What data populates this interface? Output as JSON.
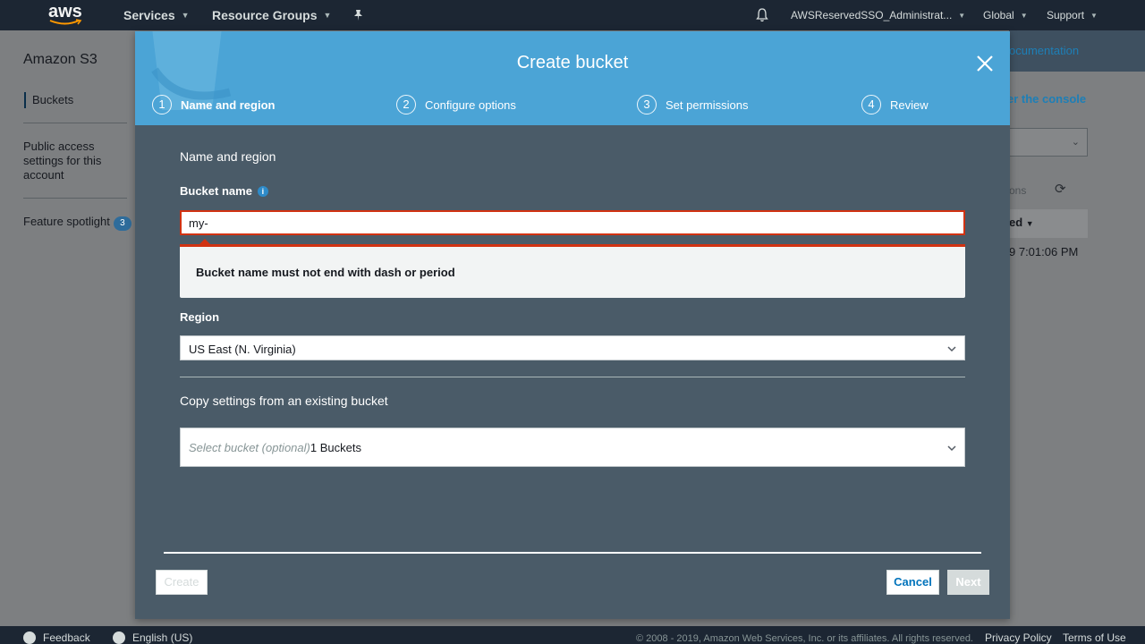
{
  "topnav": {
    "logo": "aws",
    "services": "Services",
    "resource_groups": "Resource Groups",
    "account": "AWSReservedSSO_Administrat...",
    "region": "Global",
    "support": "Support"
  },
  "background": {
    "service_title": "Amazon S3",
    "nav": {
      "buckets": "Buckets",
      "public_access": "Public access settings for this account",
      "feature_spotlight": "Feature spotlight",
      "feature_spotlight_count": "3"
    },
    "doc_link": "ocumentation",
    "console_link": "er the console",
    "options_text": "ons",
    "table_header": "ed",
    "table_cell": "9 7:01:06 PM"
  },
  "modal": {
    "title": "Create bucket",
    "steps": [
      {
        "num": "1",
        "label": "Name and region"
      },
      {
        "num": "2",
        "label": "Configure options"
      },
      {
        "num": "3",
        "label": "Set permissions"
      },
      {
        "num": "4",
        "label": "Review"
      }
    ],
    "section_title": "Name and region",
    "bucket_name_label": "Bucket name",
    "bucket_name_value": "my-",
    "error_message": "Bucket name must not end with dash or period",
    "region_label": "Region",
    "region_value": "US East (N. Virginia)",
    "copy_title": "Copy settings from an existing bucket",
    "copy_placeholder": "Select bucket (optional)",
    "copy_count": "1 Buckets",
    "buttons": {
      "create": "Create",
      "cancel": "Cancel",
      "next": "Next"
    }
  },
  "footer": {
    "feedback": "Feedback",
    "language": "English (US)",
    "copyright": "© 2008 - 2019, Amazon Web Services, Inc. or its affiliates. All rights reserved.",
    "privacy": "Privacy Policy",
    "terms": "Terms of Use"
  },
  "colors": {
    "header_blue": "#4ba4d6",
    "modal_bg": "#4a5b68",
    "error_red": "#d13212",
    "link_blue": "#0073bb"
  }
}
